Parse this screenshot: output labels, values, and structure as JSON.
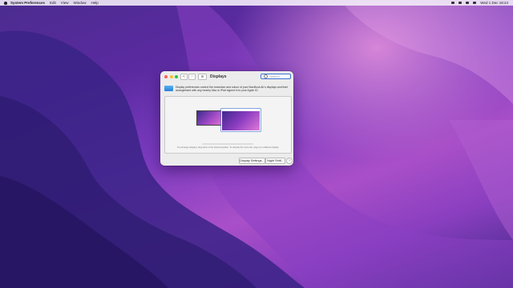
{
  "menubar": {
    "app_name": "System Preferences",
    "items": [
      "Edit",
      "View",
      "Window",
      "Help"
    ],
    "clock": "Wed 1 Dec  18:24"
  },
  "window": {
    "title": "Displays",
    "nav_back": "<",
    "nav_forward": ">",
    "grid_label": "⊞",
    "search_placeholder": "Search",
    "description": "Display preferences control the resolution and colour of your MacBook Air's displays and their arrangement with any nearby Mac or iPad signed in to your Apple ID.",
    "arrangement_hint": "To rearrange displays, drag them to the desired position. To relocate the menu bar, drag it to a different display.",
    "buttons": {
      "display_settings": "Display Settings...",
      "night_shift": "Night Shift...",
      "help": "?"
    }
  },
  "colors": {
    "close": "#ff5f57",
    "minimize": "#febc2e",
    "zoom": "#28c840",
    "accent": "#3b6fd0"
  }
}
